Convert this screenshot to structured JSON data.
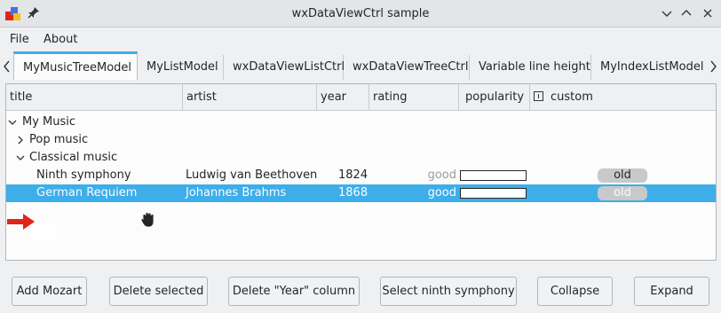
{
  "window": {
    "title": "wxDataViewCtrl sample"
  },
  "menu": {
    "items": [
      "File",
      "About"
    ]
  },
  "tabs": [
    {
      "label": "MyMusicTreeModel",
      "active": true
    },
    {
      "label": "MyListModel",
      "active": false
    },
    {
      "label": "wxDataViewListCtrl",
      "active": false
    },
    {
      "label": "wxDataViewTreeCtrl",
      "active": false
    },
    {
      "label": "Variable line height",
      "active": false
    },
    {
      "label": "MyIndexListModel",
      "active": false
    }
  ],
  "columns": [
    "title",
    "artist",
    "year",
    "rating",
    "popularity",
    "custom"
  ],
  "tree": {
    "root": "My Music",
    "pop": "Pop music",
    "classical": "Classical music",
    "rows": [
      {
        "title": "Ninth symphony",
        "artist": "Ludwig van Beethoven",
        "year": "1824",
        "rating": "good",
        "popularity": 0,
        "custom": "old",
        "selected": false
      },
      {
        "title": "German Requiem",
        "artist": "Johannes Brahms",
        "year": "1868",
        "rating": "good",
        "popularity": 0,
        "custom": "old",
        "selected": true
      }
    ]
  },
  "buttons": {
    "add": "Add Mozart",
    "delete_selected": "Delete selected",
    "delete_year": "Delete \"Year\" column",
    "select_ninth": "Select ninth symphony",
    "collapse": "Collapse",
    "expand": "Expand"
  },
  "colors": {
    "accent": "#3daee9",
    "arrow": "#e0241b"
  }
}
